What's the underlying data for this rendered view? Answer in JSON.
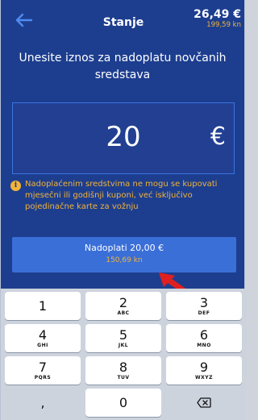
{
  "header": {
    "title": "Stanje",
    "balance_eur": "26,49 €",
    "balance_kn": "199,59 kn",
    "back_icon": "arrow-left-icon"
  },
  "prompt": "Unesite iznos za nadoplatu novčanih sredstava",
  "amount": {
    "value": "20",
    "currency": "€"
  },
  "notice": {
    "icon": "info-icon",
    "icon_glyph": "i",
    "text": "Nadoplaćenim sredstvima ne mogu se kupovati mjesečni ili godišnji kuponi, već isključivo pojedinačne karte za vožnju"
  },
  "pay_button": {
    "label": "Nadoplati 20,00 €",
    "sub_label": "150,69 kn"
  },
  "keypad": {
    "keys": [
      {
        "digit": "1",
        "letters": ""
      },
      {
        "digit": "2",
        "letters": "ABC"
      },
      {
        "digit": "3",
        "letters": "DEF"
      },
      {
        "digit": "4",
        "letters": "GHI"
      },
      {
        "digit": "5",
        "letters": "JKL"
      },
      {
        "digit": "6",
        "letters": "MNO"
      },
      {
        "digit": "7",
        "letters": "PQRS"
      },
      {
        "digit": "8",
        "letters": "TUV"
      },
      {
        "digit": "9",
        "letters": "WXYZ"
      }
    ],
    "comma": ",",
    "zero": "0",
    "backspace_icon": "backspace-icon"
  },
  "colors": {
    "background": "#1d3e8f",
    "accent": "#3a6fd8",
    "warning": "#f2b338",
    "annotation_arrow": "#e02020"
  }
}
